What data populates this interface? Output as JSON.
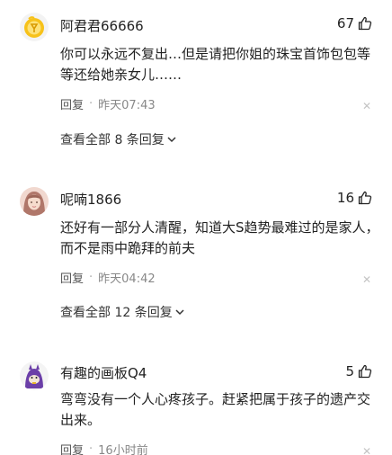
{
  "comments": [
    {
      "username": "阿君君66666",
      "likes": "67",
      "text": "你可以永远不复出…但是请把你姐的珠宝首饰包包等等还给她亲女儿……",
      "reply_label": "回复",
      "time": "昨天07:43",
      "more_replies": "查看全部 8 条回复",
      "avatar_icon": "yellow-coin-avatar-icon"
    },
    {
      "username": "呢喃1866",
      "likes": "16",
      "text": "还好有一部分人清醒，知道大S趋势最难过的是家人，而不是雨中跪拜的前夫",
      "reply_label": "回复",
      "time": "昨天04:42",
      "more_replies": "查看全部 12 条回复",
      "avatar_icon": "girl-photo-avatar-icon"
    },
    {
      "username": "有趣的画板Q4",
      "likes": "5",
      "text": "弯弯没有一个人心疼孩子。赶紧把属于孩子的遗产交出来。",
      "reply_label": "回复",
      "time": "16小时前",
      "avatar_icon": "purple-cartoon-avatar-icon"
    }
  ],
  "colors": {
    "text": "#222222",
    "meta": "#888888",
    "close": "#c4c4c4"
  }
}
